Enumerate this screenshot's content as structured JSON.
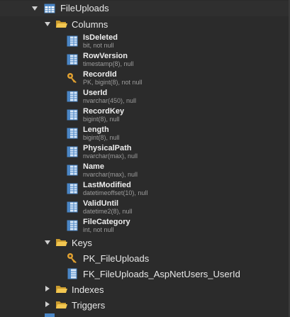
{
  "tree": {
    "table": {
      "label": "FileUploads",
      "icon": "table-icon"
    },
    "columns_folder": {
      "label": "Columns",
      "icon": "folder-open-icon"
    },
    "columns": [
      {
        "name": "IsDeleted",
        "type": "bit, not null",
        "icon": "column-icon"
      },
      {
        "name": "RowVersion",
        "type": "timestamp(8), null",
        "icon": "column-icon"
      },
      {
        "name": "RecordId",
        "type": "PK, bigint(8), not null",
        "icon": "key-icon"
      },
      {
        "name": "UserId",
        "type": "nvarchar(450), null",
        "icon": "column-icon"
      },
      {
        "name": "RecordKey",
        "type": "bigint(8), null",
        "icon": "column-icon"
      },
      {
        "name": "Length",
        "type": "bigint(8), null",
        "icon": "column-icon"
      },
      {
        "name": "PhysicalPath",
        "type": "nvarchar(max), null",
        "icon": "column-icon"
      },
      {
        "name": "Name",
        "type": "nvarchar(max), null",
        "icon": "column-icon"
      },
      {
        "name": "LastModified",
        "type": "datetimeoffset(10), null",
        "icon": "column-icon"
      },
      {
        "name": "ValidUntil",
        "type": "datetime2(8), null",
        "icon": "column-icon"
      },
      {
        "name": "FileCategory",
        "type": "int, not null",
        "icon": "column-icon"
      }
    ],
    "keys_folder": {
      "label": "Keys",
      "icon": "folder-open-icon"
    },
    "keys": [
      {
        "label": "PK_FileUploads",
        "icon": "key-icon"
      },
      {
        "label": "FK_FileUploads_AspNetUsers_UserId",
        "icon": "foreign-key-icon"
      }
    ],
    "indexes_folder": {
      "label": "Indexes",
      "icon": "folder-icon"
    },
    "triggers_folder": {
      "label": "Triggers",
      "icon": "folder-icon"
    }
  },
  "colors": {
    "background": "#2b2b2b",
    "folder": "#e6b84a",
    "table_icon": "#6fa8dc",
    "key": "#e0a030"
  }
}
